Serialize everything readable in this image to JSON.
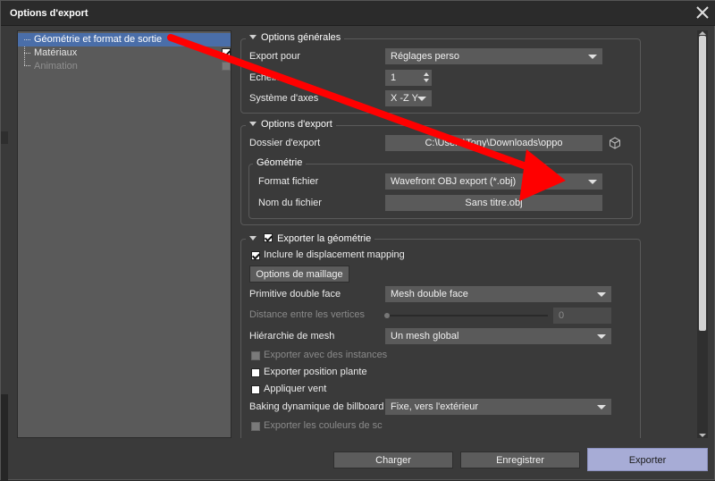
{
  "window": {
    "title": "Options d'export"
  },
  "tree": [
    {
      "label": "Géométrie et format de sortie",
      "selected": true,
      "checked": false,
      "disabled": false
    },
    {
      "label": "Matériaux",
      "selected": false,
      "checked": true,
      "disabled": false
    },
    {
      "label": "Animation",
      "selected": false,
      "checked": false,
      "disabled": true
    }
  ],
  "general": {
    "title": "Options générales",
    "export_for_label": "Export pour",
    "export_for_value": "Réglages perso",
    "scale_label": "Echelle",
    "scale_value": "1",
    "axes_label": "Système d'axes",
    "axes_value": "X -Z Y"
  },
  "export_options": {
    "title": "Options d'export",
    "folder_label": "Dossier d'export",
    "folder_value": "C:\\Users\\Tony\\Downloads\\oppo",
    "geometry_title": "Géométrie",
    "format_label": "Format fichier",
    "format_value": "Wavefront OBJ export (*.obj)",
    "filename_label": "Nom du fichier",
    "filename_value": "Sans titre.obj"
  },
  "geometry": {
    "title": "Exporter la géométrie",
    "include_displacement": "Inclure le displacement mapping",
    "mesh_options_button": "Options de maillage",
    "double_face_label": "Primitive double face",
    "double_face_value": "Mesh double face",
    "vertex_distance_label": "Distance entre les vertices",
    "vertex_distance_value": "0",
    "mesh_hierarchy_label": "Hiérarchie de mesh",
    "mesh_hierarchy_value": "Un mesh global",
    "export_instances": "Exporter avec des instances",
    "export_plant_position": "Exporter position plante",
    "apply_wind": "Appliquer vent",
    "billboard_label": "Baking dynamique de billboard",
    "billboard_value": "Fixe, vers l'extérieur",
    "export_colors": "Exporter les couleurs de sc"
  },
  "footer": {
    "load_button": "Charger",
    "save_button": "Enregistrer",
    "export_button": "Exporter"
  },
  "colors": {
    "selection": "#4a6ea9",
    "annotation_arrow": "#ff0000",
    "primary_button": "#a7acd6"
  }
}
